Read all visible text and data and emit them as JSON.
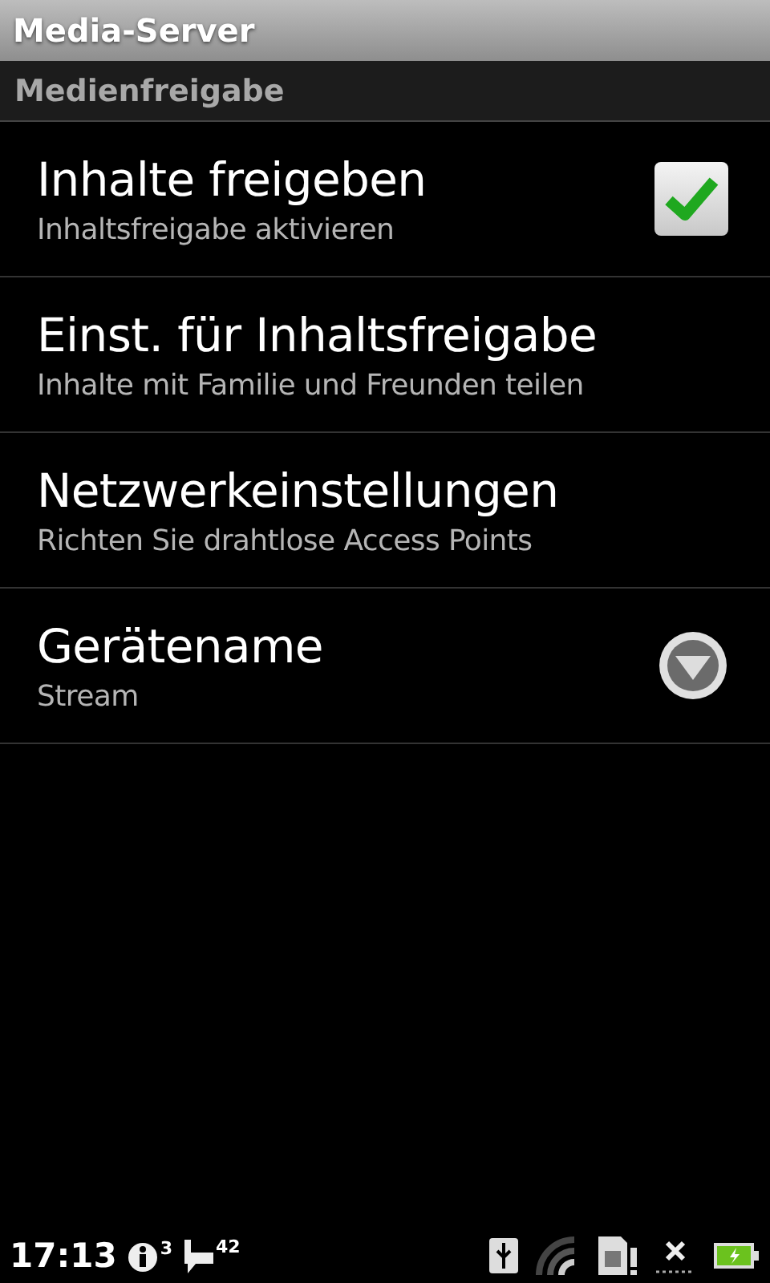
{
  "window": {
    "title": "Media-Server"
  },
  "section": {
    "title": "Medienfreigabe"
  },
  "items": [
    {
      "kind": "checkbox",
      "title": "Inhalte freigeben",
      "summary": "Inhaltsfreigabe aktivieren",
      "checked": true
    },
    {
      "kind": "plain",
      "title": "Einst. für Inhaltsfreigabe",
      "summary": "Inhalte mit Familie und Freunden teilen"
    },
    {
      "kind": "plain",
      "title": "Netzwerkeinstellungen",
      "summary": "Richten Sie drahtlose Access Points"
    },
    {
      "kind": "dropdown",
      "title": "Gerätename",
      "summary": "Stream"
    }
  ],
  "status_bar": {
    "time": "17:13",
    "info_count": "3",
    "message_count": "42"
  }
}
